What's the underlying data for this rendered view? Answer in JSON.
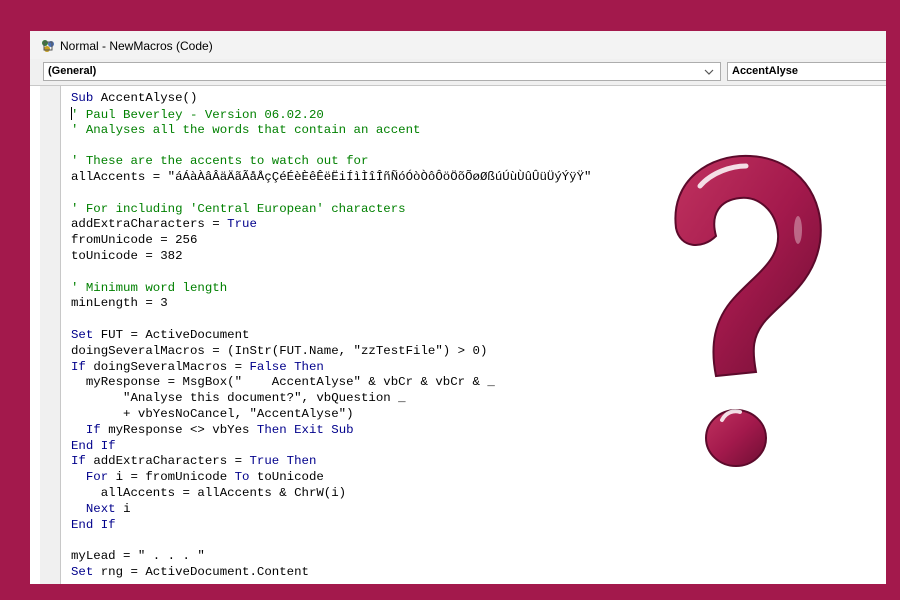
{
  "window": {
    "title": "Normal - NewMacros (Code)"
  },
  "toolbar": {
    "object_dropdown": "(General)",
    "procedure_dropdown": "AccentAlyse"
  },
  "code_lines": [
    [
      {
        "t": "Sub ",
        "c": "kw"
      },
      {
        "t": "AccentAlyse()",
        "c": ""
      }
    ],
    [
      {
        "t": "",
        "c": "caret"
      },
      {
        "t": "' Paul Beverley - Version 06.02.20",
        "c": "cm"
      }
    ],
    [
      {
        "t": "' Analyses all the words that contain an accent",
        "c": "cm"
      }
    ],
    [],
    [
      {
        "t": "' These are the accents to watch out for",
        "c": "cm"
      }
    ],
    [
      {
        "t": "allAccents = \"áÁàÀâÂäÄãÃåÅçÇéÉèÈêÊëËiÍìÌîÎñÑóÓòÒôÔöÖõÕøØßúÚùÙûÛüÜýÝÿŸ\"",
        "c": ""
      }
    ],
    [],
    [
      {
        "t": "' For including 'Central European' characters",
        "c": "cm"
      }
    ],
    [
      {
        "t": "addExtraCharacters = ",
        "c": ""
      },
      {
        "t": "True",
        "c": "kw"
      }
    ],
    [
      {
        "t": "fromUnicode = 256",
        "c": ""
      }
    ],
    [
      {
        "t": "toUnicode = 382",
        "c": ""
      }
    ],
    [],
    [
      {
        "t": "' Minimum word length",
        "c": "cm"
      }
    ],
    [
      {
        "t": "minLength = 3",
        "c": ""
      }
    ],
    [],
    [
      {
        "t": "Set ",
        "c": "kw"
      },
      {
        "t": "FUT = ActiveDocument",
        "c": ""
      }
    ],
    [
      {
        "t": "doingSeveralMacros = (InStr(FUT.Name, \"zzTestFile\") > 0)",
        "c": ""
      }
    ],
    [
      {
        "t": "If ",
        "c": "kw"
      },
      {
        "t": "doingSeveralMacros = ",
        "c": ""
      },
      {
        "t": "False Then",
        "c": "kw"
      }
    ],
    [
      {
        "t": "  myResponse = MsgBox(\"    AccentAlyse\" & vbCr & vbCr & _",
        "c": ""
      }
    ],
    [
      {
        "t": "       \"Analyse this document?\", vbQuestion _",
        "c": ""
      }
    ],
    [
      {
        "t": "       + vbYesNoCancel, \"AccentAlyse\")",
        "c": ""
      }
    ],
    [
      {
        "t": "  If ",
        "c": "kw"
      },
      {
        "t": "myResponse <> vbYes ",
        "c": ""
      },
      {
        "t": "Then Exit Sub",
        "c": "kw"
      }
    ],
    [
      {
        "t": "End If",
        "c": "kw"
      }
    ],
    [
      {
        "t": "If ",
        "c": "kw"
      },
      {
        "t": "addExtraCharacters = ",
        "c": ""
      },
      {
        "t": "True Then",
        "c": "kw"
      }
    ],
    [
      {
        "t": "  For ",
        "c": "kw"
      },
      {
        "t": "i = fromUnicode ",
        "c": ""
      },
      {
        "t": "To ",
        "c": "kw"
      },
      {
        "t": "toUnicode",
        "c": ""
      }
    ],
    [
      {
        "t": "    allAccents = allAccents & ChrW(i)",
        "c": ""
      }
    ],
    [
      {
        "t": "  Next ",
        "c": "kw"
      },
      {
        "t": "i",
        "c": ""
      }
    ],
    [
      {
        "t": "End If",
        "c": "kw"
      }
    ],
    [],
    [
      {
        "t": "myLead = \" . . . \"",
        "c": ""
      }
    ],
    [
      {
        "t": "Set ",
        "c": "kw"
      },
      {
        "t": "rng = ActiveDocument.Content",
        "c": ""
      }
    ]
  ],
  "colors": {
    "background": "#a3194c",
    "keyword": "#00008b",
    "comment": "#008000",
    "question_mark": "#a3194c"
  },
  "icons": {
    "title_icon": "vba-macro-icon",
    "dropdown_chevron": "chevron-down-icon",
    "decoration": "question-mark-icon"
  }
}
